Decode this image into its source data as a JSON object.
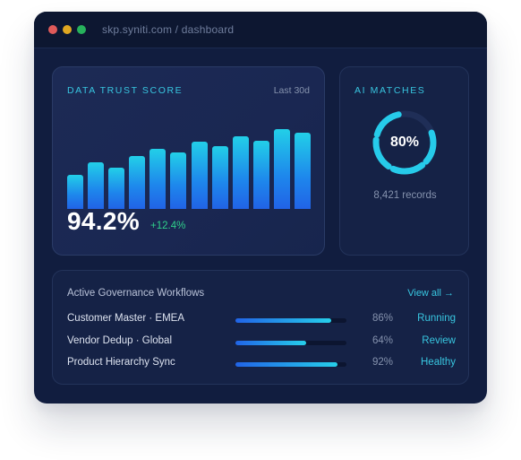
{
  "window": {
    "url": "skp.syniti.com / dashboard"
  },
  "trust": {
    "label": "DATA TRUST SCORE",
    "period": "Last 30d",
    "score": "94.2%",
    "delta": "+12.4%",
    "bar_values": [
      0.33,
      0.46,
      0.4,
      0.52,
      0.59,
      0.55,
      0.66,
      0.61,
      0.71,
      0.67,
      0.78,
      0.75
    ]
  },
  "ai": {
    "label": "AI MATCHES",
    "value": "80%",
    "fraction": 0.8,
    "records": "8,421 records"
  },
  "workflows": {
    "title": "Active Governance Workflows",
    "view_all": "View all →",
    "rows": [
      {
        "name": "Customer Master · EMEA",
        "pct": "86%",
        "fraction": 0.86,
        "status": "Running"
      },
      {
        "name": "Vendor Dedup · Global",
        "pct": "64%",
        "fraction": 0.64,
        "status": "Review"
      },
      {
        "name": "Product Hierarchy Sync",
        "pct": "92%",
        "fraction": 0.92,
        "status": "Healthy"
      }
    ]
  },
  "colors": {
    "accent": "#38c6e0",
    "positive": "#2fd08a",
    "ring_track": "#1f2e57"
  }
}
